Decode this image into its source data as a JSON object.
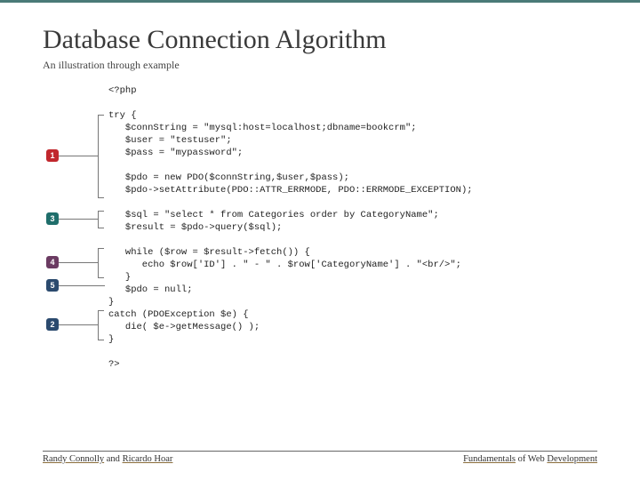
{
  "title": "Database Connection Algorithm",
  "subtitle": "An illustration through example",
  "code": "<?php\n\ntry {\n   $connString = \"mysql:host=localhost;dbname=bookcrm\";\n   $user = \"testuser\";\n   $pass = \"mypassword\";\n\n   $pdo = new PDO($connString,$user,$pass);\n   $pdo->setAttribute(PDO::ATTR_ERRMODE, PDO::ERRMODE_EXCEPTION);\n\n   $sql = \"select * from Categories order by CategoryName\";\n   $result = $pdo->query($sql);\n\n   while ($row = $result->fetch()) {\n      echo $row['ID'] . \" - \" . $row['CategoryName'] . \"<br/>\";\n   }\n   $pdo = null;\n}\ncatch (PDOException $e) {\n   die( $e->getMessage() );\n}\n\n?>",
  "callouts": {
    "c1": "1",
    "c2": "2",
    "c3": "3",
    "c4": "4",
    "c5": "5"
  },
  "footer": {
    "left_a": "Randy Connolly",
    "left_mid": " and ",
    "left_b": "Ricardo Hoar",
    "right_a": "Fundamentals",
    "right_mid": " of Web ",
    "right_b": "Development"
  }
}
